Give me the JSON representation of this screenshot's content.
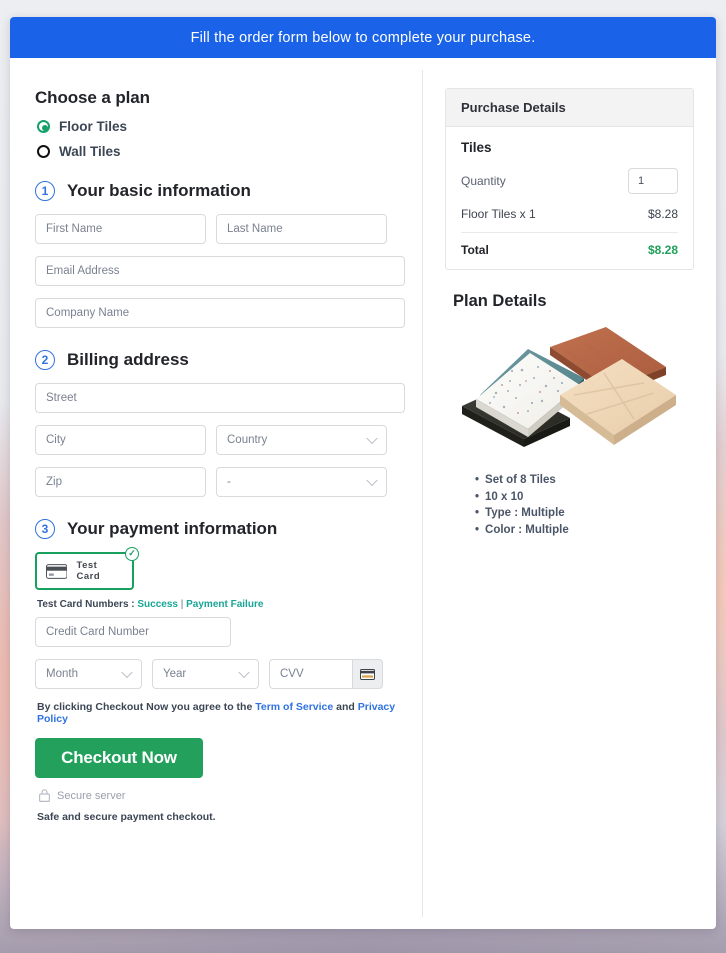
{
  "banner": {
    "text": "Fill the order form below to complete your purchase."
  },
  "plan": {
    "title": "Choose a plan",
    "options": [
      {
        "label": "Floor Tiles",
        "selected": true
      },
      {
        "label": "Wall Tiles",
        "selected": false
      }
    ]
  },
  "steps": {
    "basic": {
      "number": "1",
      "title": "Your basic information"
    },
    "billing": {
      "number": "2",
      "title": "Billing address"
    },
    "payment": {
      "number": "3",
      "title": "Your payment information"
    }
  },
  "basic_fields": {
    "first_name": "First Name",
    "last_name": "Last Name",
    "email": "Email Address",
    "company": "Company Name"
  },
  "billing_fields": {
    "street": "Street",
    "city": "City",
    "country": "Country",
    "zip": "Zip",
    "state": "-"
  },
  "payment": {
    "test_card_label": "Test  Card",
    "card_icon": "credit-card-icon",
    "selected_badge": "✓",
    "test_numbers_prefix": "Test Card Numbers : ",
    "success_link": "Success",
    "separator": " | ",
    "failure_link": "Payment Failure",
    "card_number": "Credit Card Number",
    "month": "Month",
    "year": "Year",
    "cvv": "CVV",
    "cvv_icon": "credit-card-icon"
  },
  "terms": {
    "prefix": "By clicking Checkout Now you agree to the ",
    "tos": "Term of Service",
    "and": " and ",
    "privacy": "Privacy Policy"
  },
  "checkout": {
    "button_label": "Checkout Now",
    "secure_icon": "lock-icon",
    "secure_label": "Secure server",
    "safe_note": "Safe and secure payment checkout."
  },
  "purchase": {
    "panel_title": "Purchase Details",
    "item_group": "Tiles",
    "quantity_label": "Quantity",
    "quantity_value": "1",
    "line_item_label": "Floor Tiles x 1",
    "line_item_amount": "$8.28",
    "total_label": "Total",
    "total_amount": "$8.28"
  },
  "plan_details": {
    "title": "Plan Details",
    "image_alt": "tiles-stack-image",
    "bullets": [
      "Set of 8 Tiles",
      "10 x 10",
      "Type : Multiple",
      "Color : Multiple"
    ]
  },
  "colors": {
    "banner_blue": "#1a63e8",
    "accent_green": "#22a05c",
    "link_blue": "#2f72e0",
    "link_teal": "#18a597",
    "step_blue": "#2f72e0"
  }
}
